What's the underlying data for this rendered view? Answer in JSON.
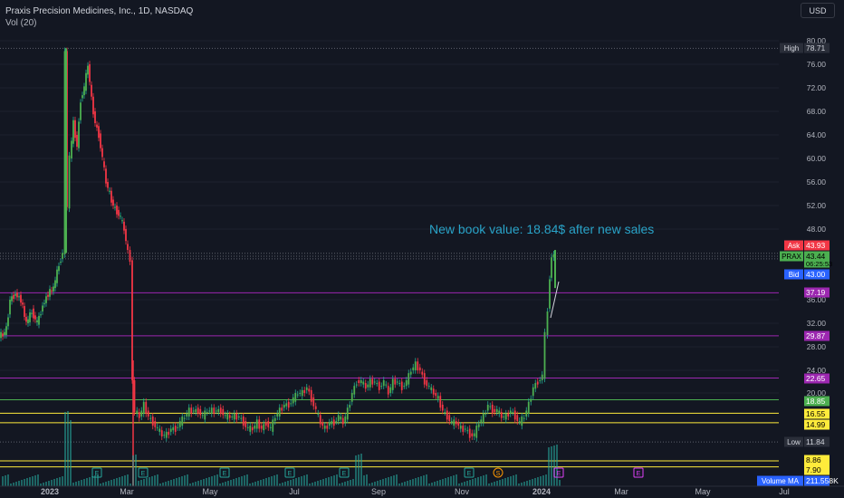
{
  "header": {
    "symbol_line": "Praxis Precision Medicines, Inc., 1D, NASDAQ",
    "indicator_line": "Vol (20)",
    "currency": "USD"
  },
  "annotation": "New book value: 18.84$ after new sales",
  "colors": {
    "background": "#131722",
    "up": "#26a69a",
    "down": "#ef5350",
    "up_bar": "#4caf50",
    "purple_line": "#9c27b0",
    "green_line": "#4caf50",
    "yellow_line": "#ffeb3b",
    "annotation": "#29a3c8"
  },
  "chart_data": {
    "type": "candlestick",
    "y_ticks": [
      "80.00",
      "76.00",
      "72.00",
      "68.00",
      "64.00",
      "60.00",
      "56.00",
      "52.00",
      "48.00",
      "36.00",
      "32.00",
      "28.00",
      "24.00",
      "20.00"
    ],
    "y_range": [
      6,
      80
    ],
    "x_ticks": [
      "2023",
      "Mar",
      "May",
      "Jul",
      "Sep",
      "Nov",
      "2024",
      "Mar",
      "May",
      "Jul"
    ],
    "price_labels": [
      {
        "tag": "High",
        "value": "78.71",
        "kind": "high"
      },
      {
        "tag": "Ask",
        "value": "43.93",
        "kind": "ask"
      },
      {
        "tag": "PRAX",
        "value": "43.44",
        "sub": "06:25:53",
        "kind": "last"
      },
      {
        "tag": "Bid",
        "value": "43.00",
        "kind": "bid"
      },
      {
        "tag": "",
        "value": "37.19",
        "kind": "purple"
      },
      {
        "tag": "",
        "value": "29.87",
        "kind": "purple"
      },
      {
        "tag": "",
        "value": "22.65",
        "kind": "purple"
      },
      {
        "tag": "",
        "value": "18.85",
        "kind": "green"
      },
      {
        "tag": "",
        "value": "16.55",
        "kind": "yellow"
      },
      {
        "tag": "",
        "value": "14.99",
        "kind": "yellow"
      },
      {
        "tag": "Low",
        "value": "11.84",
        "kind": "low"
      },
      {
        "tag": "",
        "value": "8.86",
        "kind": "yellow"
      },
      {
        "tag": "",
        "value": "7.90",
        "kind": "yellow"
      },
      {
        "tag": "Volume MA",
        "value": "211.558K",
        "kind": "vol"
      }
    ],
    "horizontal_lines": [
      {
        "value": 37.19,
        "color": "purple"
      },
      {
        "value": 29.87,
        "color": "purple"
      },
      {
        "value": 22.65,
        "color": "purple"
      },
      {
        "value": 18.85,
        "color": "green"
      },
      {
        "value": 16.55,
        "color": "yellow"
      },
      {
        "value": 14.99,
        "color": "yellow"
      },
      {
        "value": 8.86,
        "color": "yellow"
      },
      {
        "value": 7.9,
        "color": "yellow"
      }
    ],
    "dotted_lines": [
      78.71,
      43.93,
      43.44,
      43.0,
      11.84
    ],
    "event_markers": [
      "E",
      "E",
      "E",
      "E",
      "E",
      "E",
      "S",
      "E",
      "E"
    ],
    "price_path": [
      [
        0,
        30
      ],
      [
        4,
        30
      ],
      [
        8,
        31
      ],
      [
        12,
        36
      ],
      [
        18,
        37
      ],
      [
        24,
        36
      ],
      [
        30,
        32
      ],
      [
        36,
        34
      ],
      [
        42,
        32
      ],
      [
        48,
        35
      ],
      [
        54,
        37
      ],
      [
        60,
        38
      ],
      [
        66,
        42
      ],
      [
        70,
        44
      ],
      [
        73,
        78
      ],
      [
        75,
        52
      ],
      [
        78,
        60
      ],
      [
        82,
        66
      ],
      [
        86,
        62
      ],
      [
        90,
        70
      ],
      [
        94,
        72
      ],
      [
        98,
        76
      ],
      [
        102,
        70
      ],
      [
        106,
        66
      ],
      [
        110,
        64
      ],
      [
        114,
        60
      ],
      [
        118,
        56
      ],
      [
        122,
        54
      ],
      [
        126,
        52
      ],
      [
        130,
        51
      ],
      [
        134,
        50
      ],
      [
        138,
        48
      ],
      [
        142,
        44
      ],
      [
        145,
        43
      ],
      [
        147,
        22
      ],
      [
        150,
        17
      ],
      [
        155,
        16
      ],
      [
        160,
        18
      ],
      [
        165,
        16
      ],
      [
        170,
        15
      ],
      [
        175,
        14
      ],
      [
        180,
        13
      ],
      [
        185,
        13
      ],
      [
        190,
        14
      ],
      [
        195,
        14
      ],
      [
        200,
        15
      ],
      [
        205,
        16
      ],
      [
        210,
        17
      ],
      [
        215,
        17
      ],
      [
        220,
        17
      ],
      [
        225,
        16
      ],
      [
        230,
        17
      ],
      [
        235,
        17
      ],
      [
        240,
        17
      ],
      [
        245,
        17
      ],
      [
        250,
        16
      ],
      [
        255,
        16
      ],
      [
        260,
        16
      ],
      [
        265,
        16
      ],
      [
        270,
        15
      ],
      [
        275,
        14
      ],
      [
        280,
        14
      ],
      [
        285,
        15
      ],
      [
        290,
        14
      ],
      [
        295,
        15
      ],
      [
        300,
        14
      ],
      [
        305,
        16
      ],
      [
        310,
        17
      ],
      [
        315,
        18
      ],
      [
        320,
        18
      ],
      [
        325,
        19
      ],
      [
        330,
        20
      ],
      [
        335,
        20
      ],
      [
        340,
        21
      ],
      [
        345,
        19
      ],
      [
        350,
        17
      ],
      [
        355,
        15
      ],
      [
        360,
        14
      ],
      [
        365,
        15
      ],
      [
        370,
        15
      ],
      [
        375,
        16
      ],
      [
        380,
        15
      ],
      [
        385,
        17
      ],
      [
        390,
        20
      ],
      [
        395,
        22
      ],
      [
        400,
        22
      ],
      [
        405,
        21
      ],
      [
        410,
        22
      ],
      [
        415,
        22
      ],
      [
        420,
        21
      ],
      [
        425,
        22
      ],
      [
        430,
        20
      ],
      [
        435,
        22
      ],
      [
        440,
        22
      ],
      [
        445,
        21
      ],
      [
        450,
        22
      ],
      [
        455,
        24
      ],
      [
        460,
        25
      ],
      [
        465,
        24
      ],
      [
        470,
        22
      ],
      [
        475,
        21
      ],
      [
        480,
        20
      ],
      [
        485,
        19
      ],
      [
        490,
        17
      ],
      [
        495,
        16
      ],
      [
        500,
        15
      ],
      [
        505,
        15
      ],
      [
        510,
        14
      ],
      [
        515,
        14
      ],
      [
        520,
        13
      ],
      [
        525,
        13
      ],
      [
        530,
        15
      ],
      [
        535,
        16
      ],
      [
        540,
        18
      ],
      [
        545,
        17
      ],
      [
        550,
        17
      ],
      [
        555,
        16
      ],
      [
        560,
        16
      ],
      [
        565,
        17
      ],
      [
        570,
        16
      ],
      [
        575,
        15
      ],
      [
        580,
        16
      ],
      [
        585,
        18
      ],
      [
        590,
        21
      ],
      [
        595,
        22
      ],
      [
        600,
        23
      ],
      [
        603,
        30
      ],
      [
        606,
        34
      ],
      [
        608,
        40
      ],
      [
        610,
        43
      ],
      [
        613,
        44
      ]
    ]
  }
}
